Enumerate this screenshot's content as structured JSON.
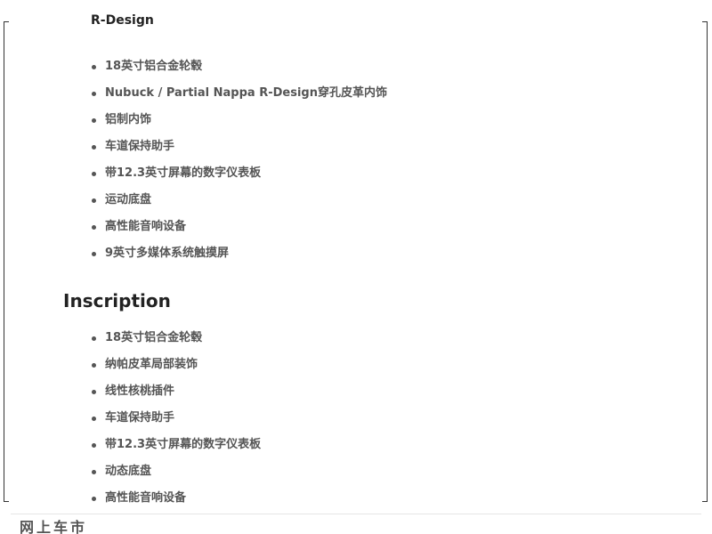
{
  "rdesign": {
    "title": "R-Design",
    "items": [
      "18英寸铝合金轮毂",
      "Nubuck / Partial Nappa R-Design穿孔皮革内饰",
      "铝制内饰",
      "车道保持助手",
      "带12.3英寸屏幕的数字仪表板",
      "运动底盘",
      "高性能音响设备",
      "9英寸多媒体系统触摸屏"
    ]
  },
  "inscription": {
    "title": "Inscription",
    "items": [
      "18英寸铝合金轮毂",
      "纳帕皮革局部装饰",
      "线性核桃插件",
      "车道保持助手",
      "带12.3英寸屏幕的数字仪表板",
      "动态底盘",
      "高性能音响设备"
    ]
  },
  "watermark": "网上车市"
}
